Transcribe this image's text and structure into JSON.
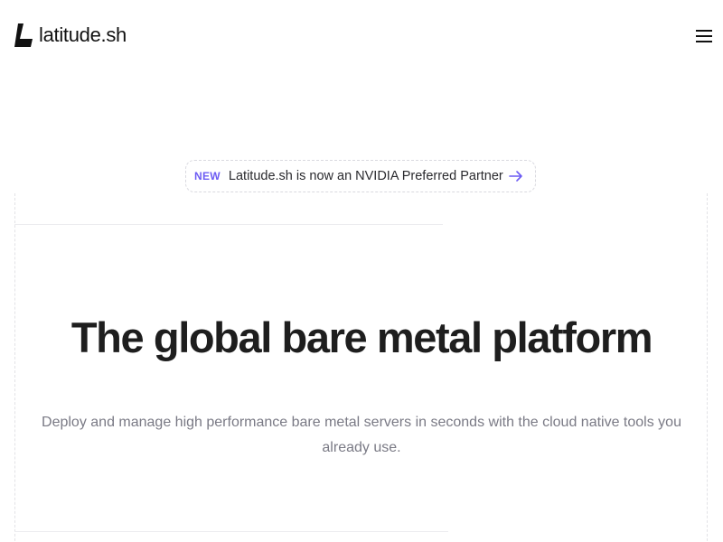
{
  "header": {
    "logo_text": "latitude.sh",
    "menu_icon": "hamburger-icon"
  },
  "announcement": {
    "badge": "NEW",
    "text": "Latitude.sh is now an NVIDIA Preferred Partner",
    "arrow_icon": "arrow-right-icon"
  },
  "hero": {
    "title": "The global bare metal platform",
    "subtitle": "Deploy and manage high performance bare metal servers in seconds with the cloud native tools you already use."
  },
  "colors": {
    "accent": "#6d5cf3",
    "text": "#1e1e1e",
    "muted": "#7a7a85"
  }
}
